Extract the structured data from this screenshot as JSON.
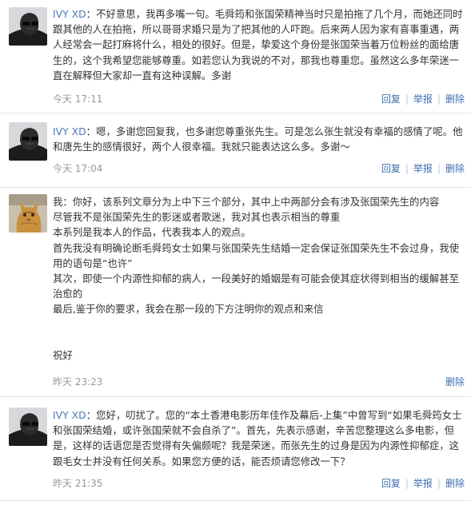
{
  "comments": [
    {
      "author": "IVY XD",
      "separator": "：",
      "text": "不好意思，我再多嘴一句。毛舜筠和张国荣精神当时只是拍拖了几个月，而她还同时跟其他的人在拍拖，所以哥哥求婚只是为了把其他的人吓跑。后来两人因为家有喜事重遇，两人经常会一起打麻将什么，相处的很好。但是，挚爱这个身份是张国荣当着万位粉丝的面给唐生的，这个我希望您能够尊重。如若您认为我说的不对，那我也尊重您。虽然这么多年荣迷一直在解释但大家却一直有这种误解。多谢",
      "time": "今天 17:11",
      "actions": [
        "回复",
        "举报",
        "删除"
      ]
    },
    {
      "author": "IVY XD",
      "separator": "：",
      "text": "嗯，多谢您回复我，也多谢您尊重张先生。可是怎么张生就没有幸福的感情了呢。他和唐先生的感情很好，两个人很幸福。我就只能表达这么多。多谢～",
      "time": "今天 17:04",
      "actions": [
        "回复",
        "举报",
        "删除"
      ]
    },
    {
      "author": "我",
      "separator": "：",
      "lines": [
        "你好，该系列文章分为上中下三个部分，其中上中两部分会有涉及张国荣先生的内容",
        "尽管我不是张国荣先生的影迷或者歌迷，我对其也表示相当的尊重",
        "本系列是我本人的作品，代表我本人的观点。",
        "首先我没有明确论断毛舜筠女士如果与张国荣先生结婚一定会保证张国荣先生不会过身，我使用的语句是“也许”",
        "其次，即使一个内源性抑郁的病人，一段美好的婚姻是有可能会使其症状得到相当的缓解甚至治愈的",
        "最后,鉴于你的要求，我会在那一段的下方注明你的观点和来信",
        "祝好"
      ],
      "time": "昨天 23:23",
      "actions": [
        "删除"
      ]
    },
    {
      "author": "IVY XD",
      "separator": "：",
      "text": "您好，叨扰了。您的“本土香港电影历年佳作及幕后-上集”中曾写到“如果毛舜筠女士和张国荣结婚，或许张国荣就不会自杀了”。首先，先表示感谢，辛苦您整理这么多电影，但是，这样的话语您是否觉得有失偏颇呢？我是荣迷，而张先生的过身是因为内源性抑郁症，这跟毛女士并没有任何关系。如果您方便的话，能否烦请您修改一下？",
      "time": "昨天 21:35",
      "actions": [
        "回复",
        "举报",
        "删除"
      ]
    }
  ]
}
